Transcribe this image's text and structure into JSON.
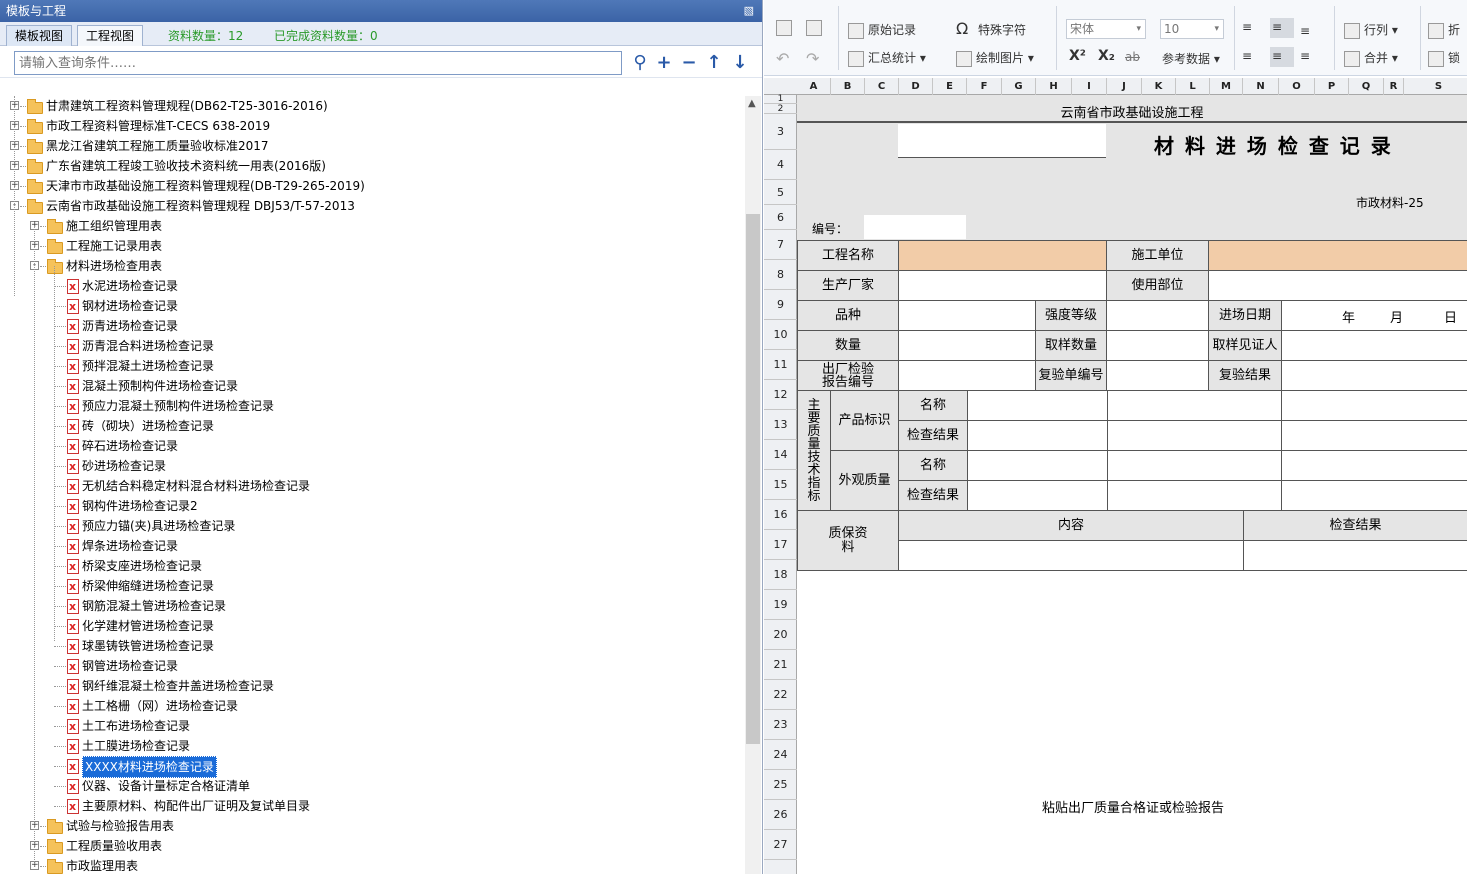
{
  "left_panel": {
    "title": "模板与工程",
    "pin_icon": "pin-icon",
    "tabs": [
      "模板视图",
      "工程视图"
    ],
    "count_label": "资料数量：12",
    "done_label": "已完成资料数量：0",
    "search_placeholder": "请输入查询条件……",
    "search_buttons": [
      "search-icon",
      "add-icon",
      "minus-icon",
      "arrow-up-icon",
      "arrow-down-icon"
    ],
    "tree": [
      {
        "label": "甘肃建筑工程资料管理规程(DB62-T25-3016-2016)",
        "level": 0,
        "type": "folder",
        "expand": "+"
      },
      {
        "label": "市政工程资料管理标准T-CECS 638-2019",
        "level": 0,
        "type": "folder",
        "expand": "+"
      },
      {
        "label": "黑龙江省建筑工程施工质量验收标准2017",
        "level": 0,
        "type": "folder",
        "expand": "+"
      },
      {
        "label": "广东省建筑工程竣工验收技术资料统一用表(2016版)",
        "level": 0,
        "type": "folder",
        "expand": "+"
      },
      {
        "label": "天津市市政基础设施工程资料管理规程(DB-T29-265-2019)",
        "level": 0,
        "type": "folder",
        "expand": "+"
      },
      {
        "label": "云南省市政基础设施工程资料管理规程 DBJ53/T-57-2013",
        "level": 0,
        "type": "folder",
        "expand": "-"
      },
      {
        "label": "施工组织管理用表",
        "level": 1,
        "type": "folder",
        "expand": "+"
      },
      {
        "label": "工程施工记录用表",
        "level": 1,
        "type": "folder",
        "expand": "+"
      },
      {
        "label": "材料进场检查用表",
        "level": 1,
        "type": "folder",
        "expand": "-"
      },
      {
        "label": "水泥进场检查记录",
        "level": 2,
        "type": "file"
      },
      {
        "label": "钢材进场检查记录",
        "level": 2,
        "type": "file"
      },
      {
        "label": "沥青进场检查记录",
        "level": 2,
        "type": "file"
      },
      {
        "label": "沥青混合料进场检查记录",
        "level": 2,
        "type": "file"
      },
      {
        "label": "预拌混凝土进场检查记录",
        "level": 2,
        "type": "file"
      },
      {
        "label": "混凝土预制构件进场检查记录",
        "level": 2,
        "type": "file"
      },
      {
        "label": "预应力混凝土预制构件进场检查记录",
        "level": 2,
        "type": "file"
      },
      {
        "label": "砖（砌块）进场检查记录",
        "level": 2,
        "type": "file"
      },
      {
        "label": "碎石进场检查记录",
        "level": 2,
        "type": "file"
      },
      {
        "label": "砂进场检查记录",
        "level": 2,
        "type": "file"
      },
      {
        "label": "无机结合料稳定材料混合材料进场检查记录",
        "level": 2,
        "type": "file"
      },
      {
        "label": "钢构件进场检查记录2",
        "level": 2,
        "type": "file"
      },
      {
        "label": "预应力锚(夹)具进场检查记录",
        "level": 2,
        "type": "file"
      },
      {
        "label": "焊条进场检查记录",
        "level": 2,
        "type": "file"
      },
      {
        "label": "桥梁支座进场检查记录",
        "level": 2,
        "type": "file"
      },
      {
        "label": "桥梁伸缩缝进场检查记录",
        "level": 2,
        "type": "file"
      },
      {
        "label": "钢筋混凝土管进场检查记录",
        "level": 2,
        "type": "file"
      },
      {
        "label": "化学建材管进场检查记录",
        "level": 2,
        "type": "file"
      },
      {
        "label": "球墨铸铁管进场检查记录",
        "level": 2,
        "type": "file"
      },
      {
        "label": "钢管进场检查记录",
        "level": 2,
        "type": "file"
      },
      {
        "label": "钢纤维混凝土检查井盖进场检查记录",
        "level": 2,
        "type": "file"
      },
      {
        "label": "土工格栅（网）进场检查记录",
        "level": 2,
        "type": "file"
      },
      {
        "label": "土工布进场检查记录",
        "level": 2,
        "type": "file"
      },
      {
        "label": "土工膜进场检查记录",
        "level": 2,
        "type": "file"
      },
      {
        "label": "XXXX材料进场检查记录",
        "level": 2,
        "type": "file",
        "selected": true
      },
      {
        "label": "仪器、设备计量标定合格证清单",
        "level": 2,
        "type": "file"
      },
      {
        "label": "主要原材料、构配件出厂证明及复试单目录",
        "level": 2,
        "type": "file"
      },
      {
        "label": "试验与检验报告用表",
        "level": 1,
        "type": "folder",
        "expand": "+"
      },
      {
        "label": "工程质量验收用表",
        "level": 1,
        "type": "folder",
        "expand": "+"
      },
      {
        "label": "市政监理用表",
        "level": 1,
        "type": "folder",
        "expand": "+"
      }
    ]
  },
  "ribbon": {
    "original_record": "原始记录",
    "special_char": "特殊字符",
    "summary_stats": "汇总统计",
    "draw_image": "绘制图片",
    "font_name": "宋体",
    "font_size": "10",
    "superscript": "X²",
    "subscript": "X₂",
    "strike": "ab",
    "ref_data": "参考数据",
    "row_col": "行列",
    "merge": "合并",
    "fold": "折",
    "lock": "锁"
  },
  "sheet": {
    "columns": [
      "A",
      "B",
      "C",
      "D",
      "E",
      "F",
      "G",
      "H",
      "I",
      "J",
      "K",
      "L",
      "M",
      "N",
      "O",
      "P",
      "Q",
      "R",
      "S"
    ],
    "rows": [
      "1",
      "2",
      "3",
      "4",
      "5",
      "6",
      "7",
      "8",
      "9",
      "10",
      "11",
      "12",
      "13",
      "14",
      "15",
      "16",
      "17",
      "18",
      "19",
      "20",
      "21",
      "22",
      "23",
      "24",
      "25",
      "26",
      "27"
    ],
    "header_project": "云南省市政基础设施工程",
    "form_title": "材 料 进 场 检 查 记 录",
    "form_code": "市政材料-25",
    "number_label": "编号：",
    "labels": {
      "project_name": "工程名称",
      "construction_unit": "施工单位",
      "manufacturer": "生产厂家",
      "use_location": "使用部位",
      "variety": "品种",
      "strength_grade": "强度等级",
      "entry_date": "进场日期",
      "year": "年",
      "month": "月",
      "day": "日",
      "quantity": "数量",
      "sample_qty": "取样数量",
      "sample_witness": "取样见证人",
      "factory_report_no": "出厂检验报告编号",
      "recheck_no": "复验单编号",
      "recheck_result": "复验结果",
      "main_quality": "主要质量技术指标",
      "product_mark": "产品标识",
      "appearance": "外观质量",
      "name": "名称",
      "check_result": "检查结果",
      "quality_docs": "质保资料",
      "content": "内容",
      "check_result2": "检查结果",
      "paste_note": "粘贴出厂质量合格证或检验报告"
    }
  }
}
